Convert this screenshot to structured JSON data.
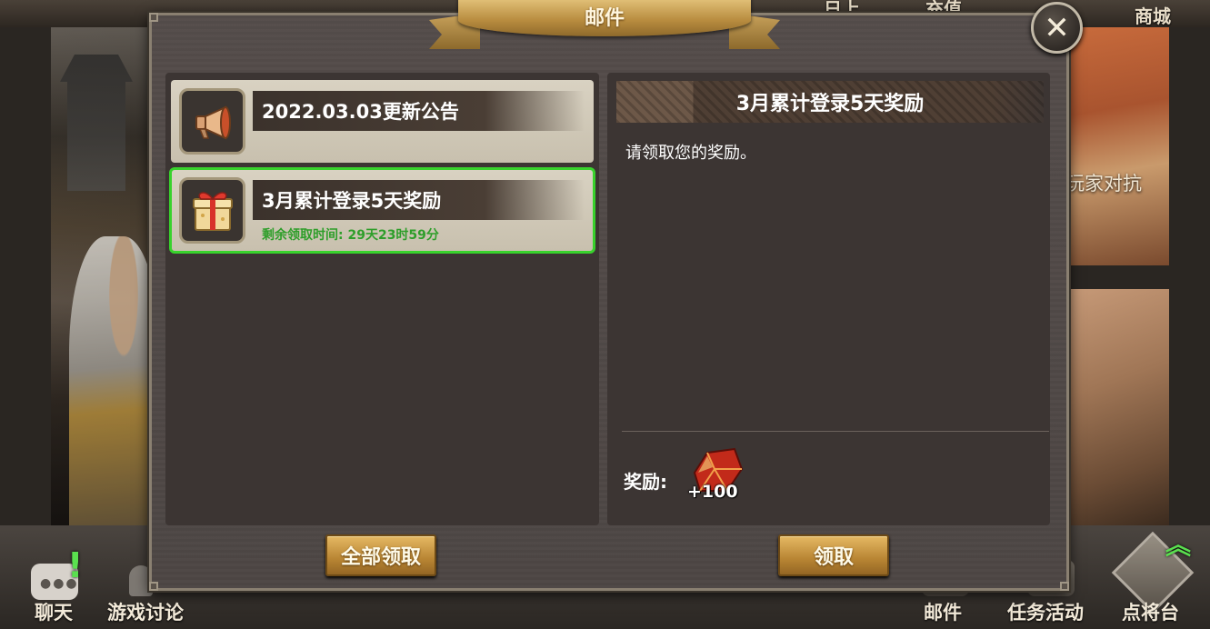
{
  "background": {
    "top_labels": [
      "日上",
      "充值",
      "商城"
    ],
    "pvp_label": "玩家对抗",
    "bottom_nav": {
      "chat": "聊天",
      "discussion": "游戏讨论",
      "mail": "邮件",
      "tasks": "任务活动",
      "general": "点将台"
    },
    "chat_alert": "!"
  },
  "modal": {
    "title": "邮件",
    "close_glyph": "✕",
    "mail_list": [
      {
        "icon": "megaphone-icon",
        "title": "2022.03.03更新公告",
        "time": ""
      },
      {
        "icon": "gift-box-icon",
        "title": "3月累计登录5天奖励",
        "time": "剩余领取时间: 29天23时59分",
        "selected": true
      }
    ],
    "detail": {
      "header": "3月累计登录5天奖励",
      "body": "请领取您的奖励。",
      "reward_label": "奖励:",
      "reward_item": {
        "icon": "red-gem-icon",
        "count": "+100"
      }
    },
    "buttons": {
      "claim_all": "全部领取",
      "claim": "领取"
    }
  },
  "colors": {
    "accent_gold": "#c99a4a",
    "selected_outline": "#38d22c",
    "time_text": "#2e9e2a"
  }
}
